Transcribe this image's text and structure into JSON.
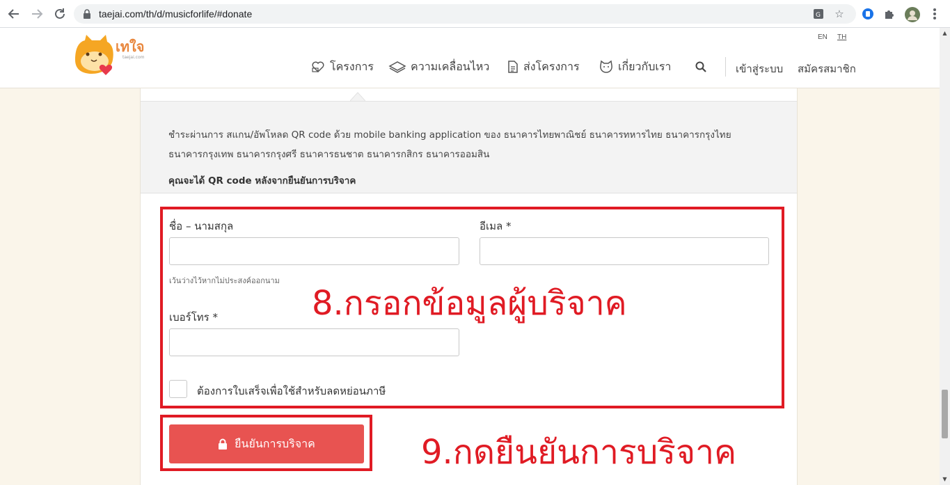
{
  "browser": {
    "url": "taejai.com/th/d/musicforlife/#donate",
    "icons": [
      "back-arrow-icon",
      "forward-arrow-icon",
      "reload-icon",
      "lock-icon",
      "translate-icon",
      "star-icon",
      "extension-icon",
      "puzzle-icon",
      "profile-avatar",
      "more-vert-icon"
    ]
  },
  "header": {
    "logo_text": "เทใจ",
    "logo_subtext": "taejai.com",
    "lang": {
      "en": "EN",
      "th": "TH"
    },
    "menu": [
      {
        "label": "โครงการ",
        "icon": "heart-hand-icon"
      },
      {
        "label": "ความเคลื่อนไหว",
        "icon": "news-icon"
      },
      {
        "label": "ส่งโครงการ",
        "icon": "document-icon"
      },
      {
        "label": "เกี่ยวกับเรา",
        "icon": "cat-face-icon"
      }
    ],
    "search_icon": "search-icon",
    "login": "เข้าสู่ระบบ",
    "register": "สมัครสมาชิก"
  },
  "info": {
    "text": "ชำระผ่านการ สแกน/อัพโหลด QR code ด้วย mobile banking application ของ ธนาคารไทยพาณิชย์ ธนาคารทหารไทย ธนาคารกรุงไทย ธนาคารกรุงเทพ ธนาคารกรุงศรี ธนาคารธนชาต ธนาคารกสิกร ธนาคารออมสิน",
    "note": "คุณจะได้ QR code หลังจากยืนยันการบริจาค"
  },
  "form": {
    "name_label": "ชื่อ – นามสกุล",
    "name_value": "",
    "name_hint": "เว้นว่างไว้หากไม่ประสงค์ออกนาม",
    "email_label": "อีเมล *",
    "email_value": "",
    "phone_label": "เบอร์โทร *",
    "phone_value": "",
    "receipt_label": "ต้องการใบเสร็จเพื่อใช้สำหรับลดหย่อนภาษี",
    "receipt_checked": false,
    "submit_label": "ยืนยันการบริจาค"
  },
  "annotations": {
    "step8": "8.กรอกข้อมูลผู้บริจาค",
    "step9": "9.กดยืนยันการบริจาค",
    "color": "#e01b24"
  },
  "colors": {
    "accent_button": "#e85351",
    "page_background": "#faf5ea",
    "logo_orange": "#f5a623"
  }
}
